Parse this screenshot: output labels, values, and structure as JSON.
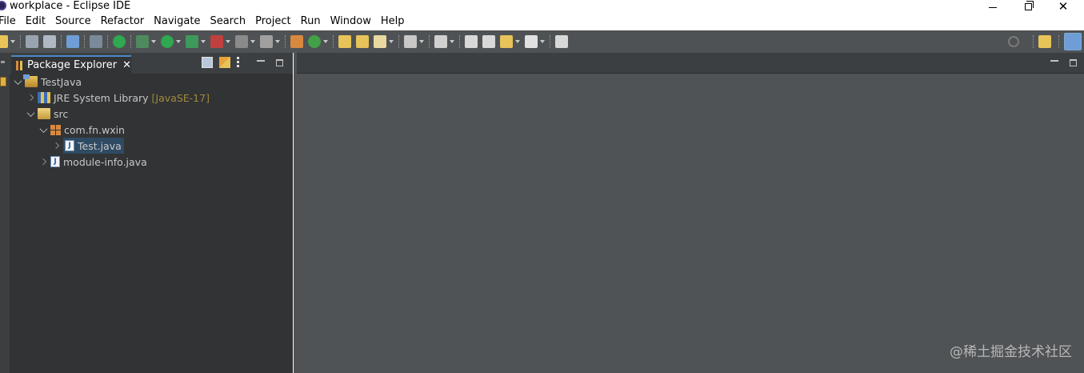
{
  "window": {
    "title": "workplace - Eclipse IDE",
    "controls": {
      "minimize": "—",
      "restore": "❐",
      "close": "✕"
    }
  },
  "menu": [
    "File",
    "Edit",
    "Source",
    "Refactor",
    "Navigate",
    "Search",
    "Project",
    "Run",
    "Window",
    "Help"
  ],
  "package_explorer": {
    "tab_label": "Package Explorer",
    "close_glyph": "✕",
    "tools": [
      "collapse-all-icon",
      "link-with-editor-icon",
      "view-menu-icon",
      "minimize-icon",
      "maximize-icon"
    ],
    "tree": {
      "project": "TestJava",
      "jre": {
        "label": "JRE System Library",
        "decoration": "[JavaSE-17]"
      },
      "src": "src",
      "package": "com.fn.wxin",
      "file_selected": "Test.java",
      "file_module": "module-info.java"
    }
  },
  "watermark": "@稀土掘金技术社区",
  "colors": {
    "toolbar": "#4e5254",
    "panel": "#313335",
    "editor": "#505356",
    "selection": "#2f4a63",
    "accent": "#4a88c7"
  }
}
